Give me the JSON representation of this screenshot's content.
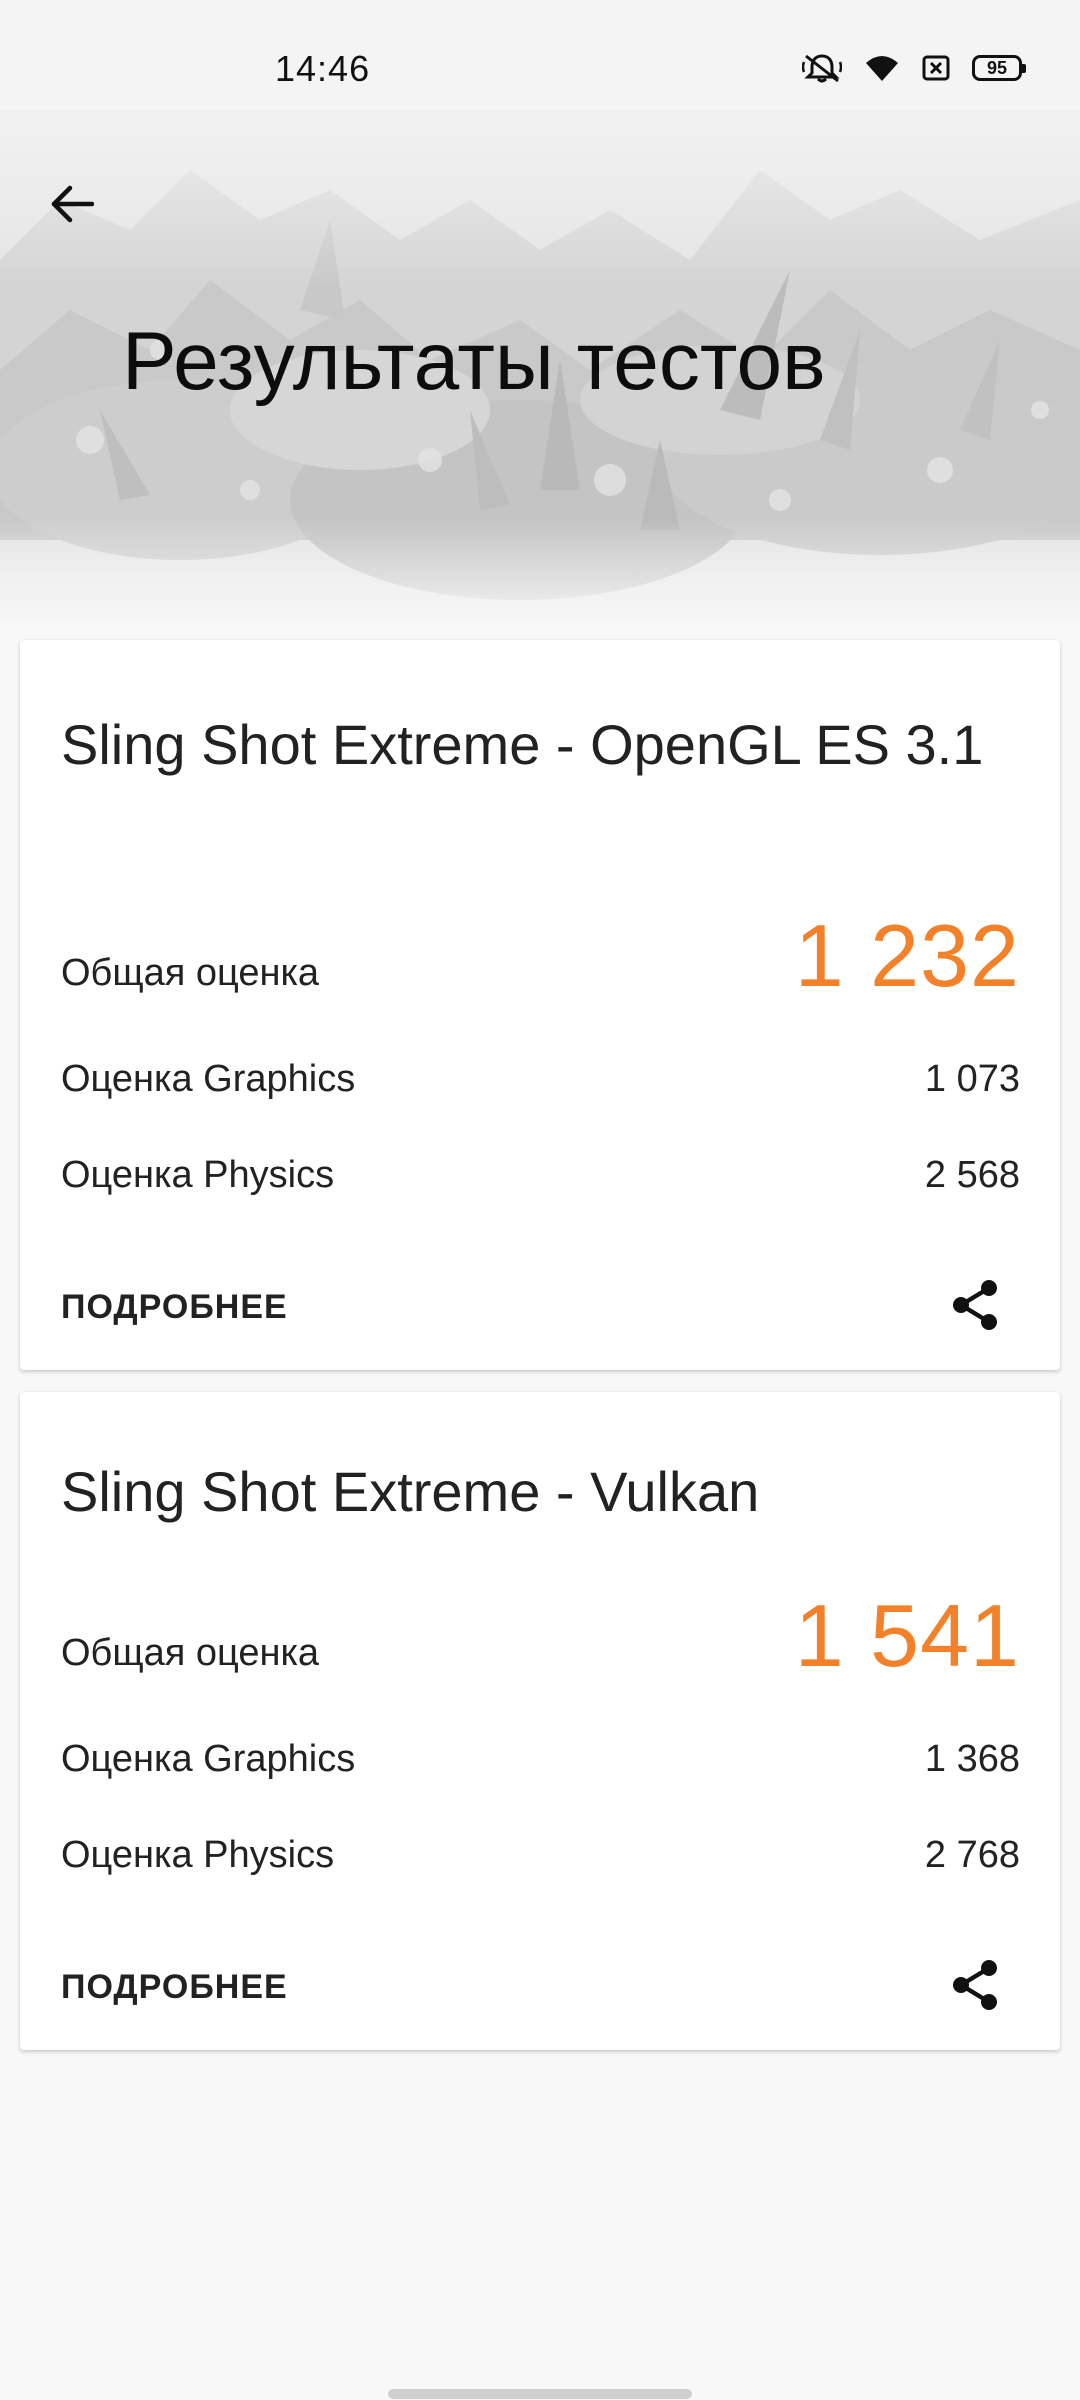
{
  "status_bar": {
    "time": "14:46",
    "battery": "95",
    "icons": [
      "mute-icon",
      "wifi-icon",
      "sim-icon",
      "battery-icon"
    ]
  },
  "header": {
    "title": "Результаты тестов",
    "back_icon": "arrow-left-icon"
  },
  "results": [
    {
      "title": "Sling Shot Extreme - OpenGL ES 3.1",
      "total_label": "Общая оценка",
      "total_value": "1 232",
      "graphics_label": "Оценка Graphics",
      "graphics_value": "1 073",
      "physics_label": "Оценка Physics",
      "physics_value": "2 568",
      "more_label": "ПОДРОБНЕЕ",
      "share_icon": "share-icon"
    },
    {
      "title": "Sling Shot Extreme - Vulkan",
      "total_label": "Общая оценка",
      "total_value": "1 541",
      "graphics_label": "Оценка Graphics",
      "graphics_value": "1 368",
      "physics_label": "Оценка Physics",
      "physics_value": "2 768",
      "more_label": "ПОДРОБНЕЕ",
      "share_icon": "share-icon"
    }
  ],
  "colors": {
    "accent": "#f2812a",
    "background": "#f8f8f8",
    "card": "#ffffff",
    "text": "#222222"
  }
}
